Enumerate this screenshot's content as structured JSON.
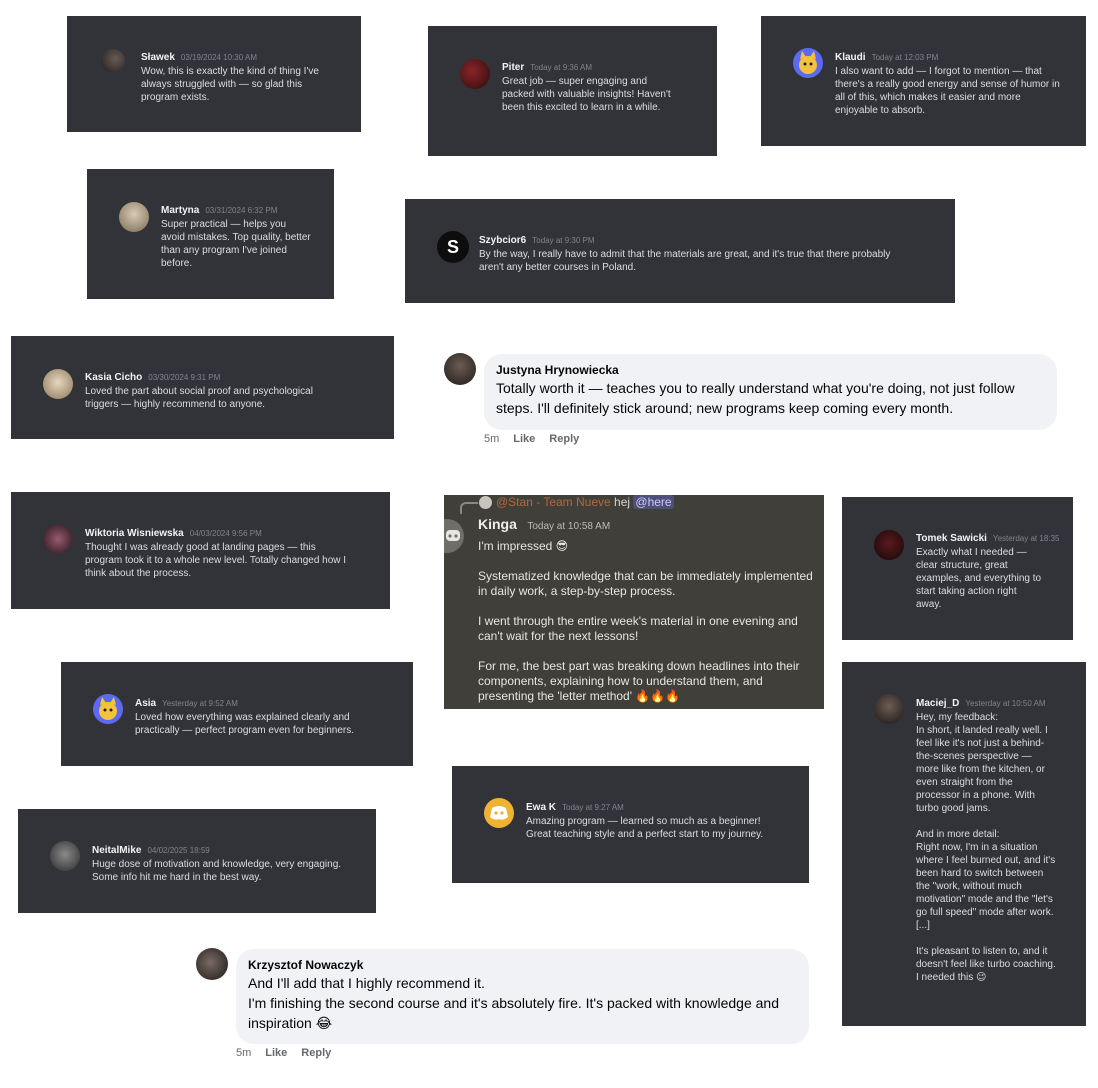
{
  "cards": {
    "slawek": {
      "name": "Sławek",
      "time": "03/19/2024 10:30 AM",
      "text": "Wow, this is exactly the kind of thing I've always struggled with — so glad this program exists."
    },
    "piter": {
      "name": "Piter",
      "time": "Today at 9:36 AM",
      "text": "Great job — super engaging and packed with valuable insights! Haven't been this excited to learn in a while."
    },
    "klaudi": {
      "name": "Klaudi",
      "time": "Today at 12:03 PM",
      "text": "I also want to add — I forgot to mention — that there's a really good energy and sense of humor in all of this, which makes it easier and more enjoyable to absorb."
    },
    "martyna": {
      "name": "Martyna",
      "time": "03/31/2024 6:32 PM",
      "text": "Super practical — helps you avoid mistakes. Top quality, better than any program I've joined before."
    },
    "szybcior": {
      "name": "Szybcior6",
      "time": "Today at 9:30 PM",
      "text": "By the way, I really have to admit that the materials are great, and it's true that there probably aren't any better courses in Poland."
    },
    "kasia": {
      "name": "Kasia Cicho",
      "time": "03/30/2024 9:31 PM",
      "text": "Loved the part about social proof and psychological triggers — highly recommend to anyone."
    },
    "wiktoria": {
      "name": "Wiktoria Wisniewska",
      "time": "04/03/2024 9:56 PM",
      "text": "Thought I was already good at landing pages — this program took it to a whole new level. Totally changed how I think about the process."
    },
    "tomek": {
      "name": "Tomek Sawicki",
      "time": "Yesterday at 18:35",
      "text": "Exactly what I needed — clear structure, great examples, and everything to start taking action right away."
    },
    "asia": {
      "name": "Asia",
      "time": "Yesterday at 9:52 AM",
      "text": "Loved how everything was explained clearly and practically — perfect program even for beginners."
    },
    "maciej": {
      "name": "Maciej_D",
      "time": "Yesterday at 10:50 AM",
      "text": "Hey, my feedback:\nIn short, it landed really well. I feel like it's not just a behind-the-scenes perspective — more like from the kitchen, or even straight from the processor in a phone. With turbo good jams.\n\nAnd in more detail:\nRight now, I'm in a situation where I feel burned out, and it's been hard to switch between the \"work, without much motivation\" mode and the \"let's go full speed\" mode after work. [...]\n\nIt's pleasant to listen to, and it doesn't feel like turbo coaching. I needed this 😉"
    },
    "ewa": {
      "name": "Ewa K",
      "time": "Today at 9:27 AM",
      "text": "Amazing program — learned so much as a beginner! Great teaching style and a perfect start to my journey."
    },
    "neital": {
      "name": "NeitalMike",
      "time": "04/02/2025 18:59",
      "text": "Huge dose of motivation and knowledge, very engaging. Some info hit me hard in the best way."
    }
  },
  "fb": {
    "justyna": {
      "name": "Justyna Hrynowiecka",
      "text": "Totally worth it — teaches you to really understand what you're doing, not just follow steps. I'll definitely stick around; new programs keep coming every month.",
      "time": "5m",
      "like": "Like",
      "reply": "Reply"
    },
    "krzysztof": {
      "name": "Krzysztof Nowaczyk",
      "text": "And I'll add that I highly recommend it.\nI'm finishing the second course and it's absolutely fire. It's packed with knowledge and inspiration 😂",
      "time": "5m",
      "like": "Like",
      "reply": "Reply"
    }
  },
  "kinga": {
    "reply_author": "@Stan - Team Nueve",
    "reply_text": "hej",
    "reply_mention": "@here",
    "name": "Kinga",
    "time": "Today at 10:58 AM",
    "p1": "I'm impressed 😎",
    "p2": "Systematized knowledge that can be immediately implemented in daily work, a step-by-step process.",
    "p3": "I went through the entire week's material in one evening and can't wait for the next lessons!",
    "p4": "For me, the best part was breaking down headlines into their components, explaining how to understand them, and presenting the 'letter method' 🔥🔥🔥"
  },
  "colors": {
    "discord_card": "#313338",
    "discord_blurple": "#5865f2",
    "fb_bubble": "#f0f2f5"
  }
}
